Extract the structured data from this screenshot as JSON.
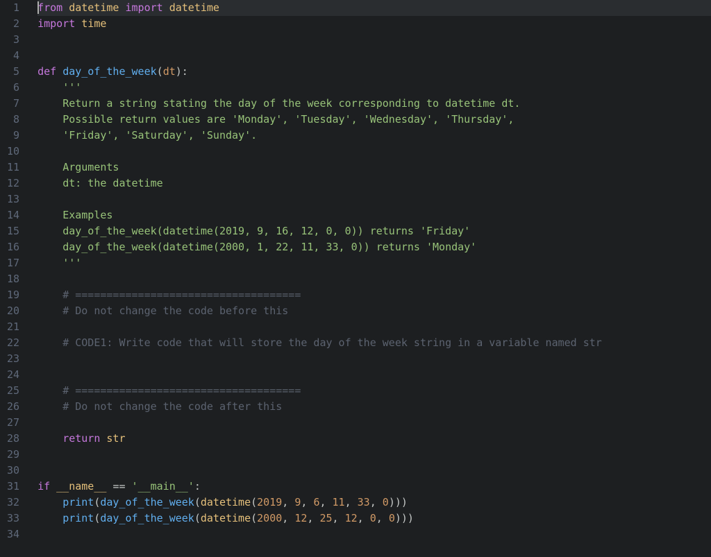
{
  "editor": {
    "line_count": 34,
    "cursor_line": 1,
    "lines": {
      "l1": {
        "tokens": [
          {
            "cls": "kw",
            "t": "from"
          },
          {
            "cls": "id",
            "t": " "
          },
          {
            "cls": "mod",
            "t": "datetime"
          },
          {
            "cls": "id",
            "t": " "
          },
          {
            "cls": "kw",
            "t": "import"
          },
          {
            "cls": "id",
            "t": " "
          },
          {
            "cls": "mod",
            "t": "datetime"
          }
        ]
      },
      "l2": {
        "tokens": [
          {
            "cls": "kw",
            "t": "import"
          },
          {
            "cls": "id",
            "t": " "
          },
          {
            "cls": "mod",
            "t": "time"
          }
        ]
      },
      "l3": {
        "tokens": []
      },
      "l4": {
        "tokens": []
      },
      "l5": {
        "tokens": [
          {
            "cls": "kw",
            "t": "def"
          },
          {
            "cls": "id",
            "t": " "
          },
          {
            "cls": "fn",
            "t": "day_of_the_week"
          },
          {
            "cls": "punc",
            "t": "("
          },
          {
            "cls": "param",
            "t": "dt"
          },
          {
            "cls": "punc",
            "t": ")"
          },
          {
            "cls": "punc",
            "t": ":"
          }
        ]
      },
      "l6": {
        "indent": "    ",
        "tokens": [
          {
            "cls": "str",
            "t": "'''"
          }
        ]
      },
      "l7": {
        "indent": "    ",
        "tokens": [
          {
            "cls": "doc",
            "t": "Return a string stating the day of the week corresponding to datetime dt."
          }
        ]
      },
      "l8": {
        "indent": "    ",
        "tokens": [
          {
            "cls": "doc",
            "t": "Possible return values are 'Monday', 'Tuesday', 'Wednesday', 'Thursday',"
          }
        ]
      },
      "l9": {
        "indent": "    ",
        "tokens": [
          {
            "cls": "doc",
            "t": "'Friday', 'Saturday', 'Sunday'."
          }
        ]
      },
      "l10": {
        "indent": "    ",
        "tokens": []
      },
      "l11": {
        "indent": "    ",
        "tokens": [
          {
            "cls": "doc",
            "t": "Arguments"
          }
        ]
      },
      "l12": {
        "indent": "    ",
        "tokens": [
          {
            "cls": "doc",
            "t": "dt: the datetime"
          }
        ]
      },
      "l13": {
        "indent": "    ",
        "tokens": []
      },
      "l14": {
        "indent": "    ",
        "tokens": [
          {
            "cls": "doc",
            "t": "Examples"
          }
        ]
      },
      "l15": {
        "indent": "    ",
        "tokens": [
          {
            "cls": "doc",
            "t": "day_of_the_week(datetime(2019, 9, 16, 12, 0, 0)) returns 'Friday'"
          }
        ]
      },
      "l16": {
        "indent": "    ",
        "tokens": [
          {
            "cls": "doc",
            "t": "day_of_the_week(datetime(2000, 1, 22, 11, 33, 0)) returns 'Monday'"
          }
        ]
      },
      "l17": {
        "indent": "    ",
        "tokens": [
          {
            "cls": "str",
            "t": "'''"
          }
        ]
      },
      "l18": {
        "indent": "    ",
        "tokens": []
      },
      "l19": {
        "indent": "    ",
        "tokens": [
          {
            "cls": "cmt",
            "t": "# ===================================="
          }
        ]
      },
      "l20": {
        "indent": "    ",
        "tokens": [
          {
            "cls": "cmt",
            "t": "# Do not change the code before this"
          }
        ]
      },
      "l21": {
        "indent": "    ",
        "tokens": []
      },
      "l22": {
        "indent": "    ",
        "tokens": [
          {
            "cls": "cmt",
            "t": "# CODE1: Write code that will store the day of the week string in a variable named str"
          }
        ]
      },
      "l23": {
        "indent": "    ",
        "tokens": []
      },
      "l24": {
        "indent": "    ",
        "tokens": []
      },
      "l25": {
        "indent": "    ",
        "tokens": [
          {
            "cls": "cmt",
            "t": "# ===================================="
          }
        ]
      },
      "l26": {
        "indent": "    ",
        "tokens": [
          {
            "cls": "cmt",
            "t": "# Do not change the code after this"
          }
        ]
      },
      "l27": {
        "indent": "    ",
        "tokens": []
      },
      "l28": {
        "indent": "    ",
        "tokens": [
          {
            "cls": "kw",
            "t": "return"
          },
          {
            "cls": "id",
            "t": " "
          },
          {
            "cls": "builtin",
            "t": "str"
          }
        ]
      },
      "l29": {
        "tokens": []
      },
      "l30": {
        "tokens": []
      },
      "l31": {
        "tokens": [
          {
            "cls": "kw",
            "t": "if"
          },
          {
            "cls": "id",
            "t": " "
          },
          {
            "cls": "builtin",
            "t": "__name__"
          },
          {
            "cls": "id",
            "t": " "
          },
          {
            "cls": "op",
            "t": "=="
          },
          {
            "cls": "id",
            "t": " "
          },
          {
            "cls": "str",
            "t": "'__main__'"
          },
          {
            "cls": "punc",
            "t": ":"
          }
        ]
      },
      "l32": {
        "indent": "    ",
        "tokens": [
          {
            "cls": "fn",
            "t": "print"
          },
          {
            "cls": "punc",
            "t": "("
          },
          {
            "cls": "fn",
            "t": "day_of_the_week"
          },
          {
            "cls": "punc",
            "t": "("
          },
          {
            "cls": "class",
            "t": "datetime"
          },
          {
            "cls": "punc",
            "t": "("
          },
          {
            "cls": "num",
            "t": "2019"
          },
          {
            "cls": "punc",
            "t": ", "
          },
          {
            "cls": "num",
            "t": "9"
          },
          {
            "cls": "punc",
            "t": ", "
          },
          {
            "cls": "num",
            "t": "6"
          },
          {
            "cls": "punc",
            "t": ", "
          },
          {
            "cls": "num",
            "t": "11"
          },
          {
            "cls": "punc",
            "t": ", "
          },
          {
            "cls": "num",
            "t": "33"
          },
          {
            "cls": "punc",
            "t": ", "
          },
          {
            "cls": "num",
            "t": "0"
          },
          {
            "cls": "punc",
            "t": ")))"
          }
        ]
      },
      "l33": {
        "indent": "    ",
        "tokens": [
          {
            "cls": "fn",
            "t": "print"
          },
          {
            "cls": "punc",
            "t": "("
          },
          {
            "cls": "fn",
            "t": "day_of_the_week"
          },
          {
            "cls": "punc",
            "t": "("
          },
          {
            "cls": "class",
            "t": "datetime"
          },
          {
            "cls": "punc",
            "t": "("
          },
          {
            "cls": "num",
            "t": "2000"
          },
          {
            "cls": "punc",
            "t": ", "
          },
          {
            "cls": "num",
            "t": "12"
          },
          {
            "cls": "punc",
            "t": ", "
          },
          {
            "cls": "num",
            "t": "25"
          },
          {
            "cls": "punc",
            "t": ", "
          },
          {
            "cls": "num",
            "t": "12"
          },
          {
            "cls": "punc",
            "t": ", "
          },
          {
            "cls": "num",
            "t": "0"
          },
          {
            "cls": "punc",
            "t": ", "
          },
          {
            "cls": "num",
            "t": "0"
          },
          {
            "cls": "punc",
            "t": ")))"
          }
        ]
      },
      "l34": {
        "tokens": []
      }
    }
  }
}
